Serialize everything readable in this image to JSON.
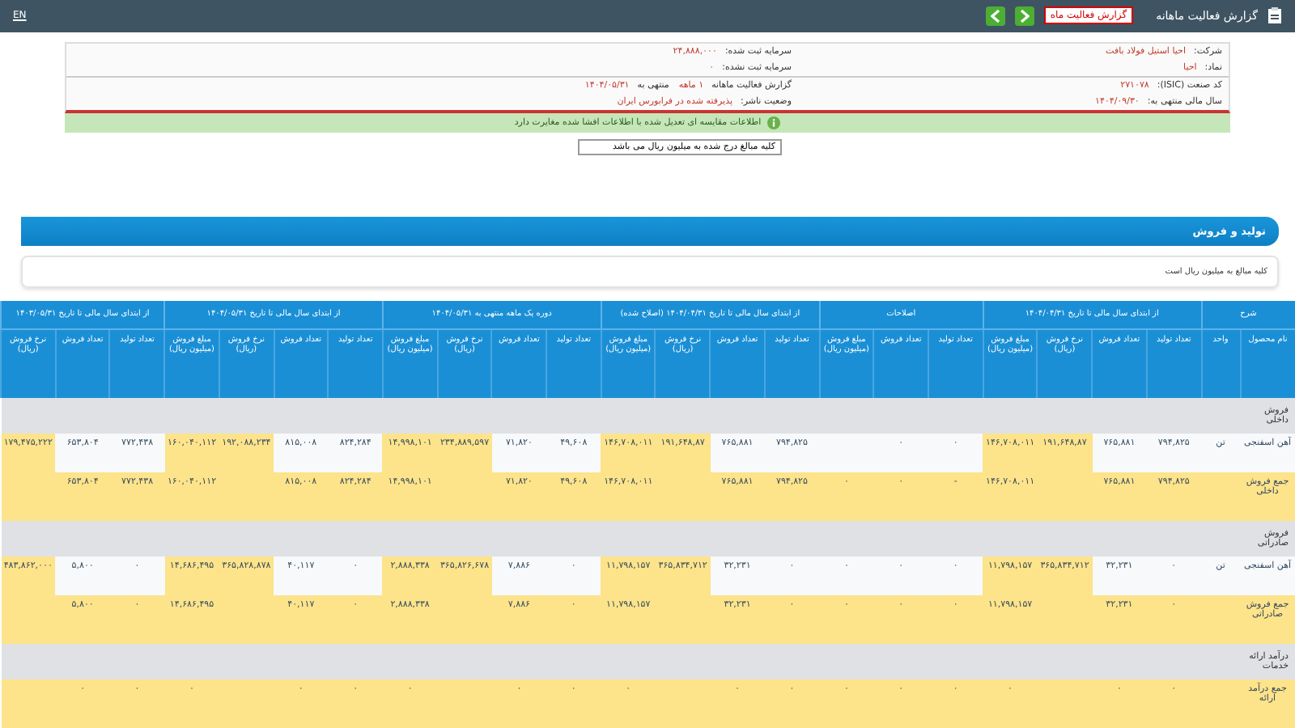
{
  "header": {
    "title": "گزارش فعالیت ماهانه",
    "badge": "گزارش فعالیت ماه",
    "language": "EN"
  },
  "info": [
    [
      {
        "label": "شرکت:",
        "value": "احیا استیل فولاد بافت"
      },
      {
        "label": "سرمایه ثبت شده:",
        "value": "۲۴,۸۸۸,۰۰۰"
      }
    ],
    [
      {
        "label": "نماد:",
        "value": "احیا"
      },
      {
        "label": "سرمایه ثبت نشده:",
        "value": "۰"
      }
    ],
    [
      {
        "label": "کد صنعت (ISIC):",
        "value": "۲۷۱۰۷۸"
      },
      {
        "label": "گزارش فعالیت ماهانه",
        "value": "۱ ماهه"
      },
      {
        "label": "منتهی به",
        "value": "۱۴۰۴/۰۵/۳۱"
      }
    ],
    [
      {
        "label": "سال مالی منتهی به:",
        "value": "۱۴۰۴/۰۹/۳۰"
      },
      {
        "label": "وضعیت ناشر:",
        "value": "پذیرفته شده در فرابورس ایران"
      }
    ]
  ],
  "notice": "اطلاعات مقایسه ای تعدیل شده با اطلاعات افشا شده مغایرت دارد",
  "unit_select": {
    "value": "کلیه مبالغ درج شده به میلیون ریال می باشد"
  },
  "section": {
    "title": "تولید و فروش",
    "note": "کلیه مبالغ به میلیون ریال است"
  },
  "table": {
    "groups": [
      {
        "label": "شرح",
        "columns": [
          {
            "label": "نام محصول",
            "kind": "text"
          },
          {
            "label": "واحد",
            "kind": "text"
          }
        ]
      },
      {
        "label": "از ابتدای سال مالی تا تاریخ ۱۴۰۴/۰۴/۳۱",
        "columns": [
          {
            "label": "تعداد تولید",
            "kind": "qty"
          },
          {
            "label": "تعداد فروش",
            "kind": "qty"
          },
          {
            "label": "نرخ فروش (ریال)",
            "kind": "rate"
          },
          {
            "label": "مبلغ فروش (میلیون ریال)",
            "kind": "amount"
          }
        ]
      },
      {
        "label": "اصلاحات",
        "columns": [
          {
            "label": "تعداد تولید",
            "kind": "qty"
          },
          {
            "label": "تعداد فروش",
            "kind": "qty"
          },
          {
            "label": "مبلغ فروش (میلیون ریال)",
            "kind": "qty"
          }
        ]
      },
      {
        "label": "از ابتدای سال مالی تا تاریخ ۱۴۰۴/۰۴/۳۱ (اصلاح شده)",
        "columns": [
          {
            "label": "تعداد تولید",
            "kind": "qty"
          },
          {
            "label": "تعداد فروش",
            "kind": "qty"
          },
          {
            "label": "نرخ فروش (ریال)",
            "kind": "rate"
          },
          {
            "label": "مبلغ فروش (میلیون ریال)",
            "kind": "amount"
          }
        ]
      },
      {
        "label": "دوره یک ماهه منتهی به ۱۴۰۴/۰۵/۳۱",
        "columns": [
          {
            "label": "تعداد تولید",
            "kind": "qty"
          },
          {
            "label": "تعداد فروش",
            "kind": "qty"
          },
          {
            "label": "نرخ فروش (ریال)",
            "kind": "rate"
          },
          {
            "label": "مبلغ فروش (میلیون ریال)",
            "kind": "amount"
          }
        ]
      },
      {
        "label": "از ابتدای سال مالی تا تاریخ ۱۴۰۴/۰۵/۳۱",
        "columns": [
          {
            "label": "تعداد تولید",
            "kind": "qty"
          },
          {
            "label": "تعداد فروش",
            "kind": "qty"
          },
          {
            "label": "نرخ فروش (ریال)",
            "kind": "rate"
          },
          {
            "label": "مبلغ فروش (میلیون ریال)",
            "kind": "amount"
          }
        ]
      },
      {
        "label": "از ابتدای سال مالی تا تاریخ ۱۴۰۳/۰۵/۳۱",
        "columns": [
          {
            "label": "تعداد تولید",
            "kind": "qty"
          },
          {
            "label": "تعداد فروش",
            "kind": "qty"
          },
          {
            "label": "نرخ فروش (ریال)",
            "kind": "rate"
          }
        ]
      }
    ],
    "rows": [
      {
        "kind": "section",
        "cells": [
          "فروش داخلی"
        ]
      },
      {
        "kind": "item",
        "cells": [
          "آهن اسفنجی",
          "تن",
          "۷۹۴,۸۲۵",
          "۷۶۵,۸۸۱",
          "۱۹۱,۶۴۸,۸۷",
          "۱۴۶,۷۰۸,۰۱۱",
          "۰",
          "۰",
          "",
          "۷۹۴,۸۲۵",
          "۷۶۵,۸۸۱",
          "۱۹۱,۶۴۸,۸۷",
          "۱۴۶,۷۰۸,۰۱۱",
          "۴۹,۶۰۸",
          "۷۱,۸۲۰",
          "۲۳۴,۸۸۹,۵۹۷",
          "۱۴,۹۹۸,۱۰۱",
          "۸۲۴,۲۸۴",
          "۸۱۵,۰۰۸",
          "۱۹۲,۰۸۸,۲۳۴",
          "۱۶۰,۰۴۰,۱۱۲",
          "۷۷۲,۴۳۸",
          "۶۵۳,۸۰۴",
          "۱۷۹,۴۷۵,۲۲۲"
        ]
      },
      {
        "kind": "total",
        "cells": [
          "جمع فروش داخلی",
          "",
          "۷۹۴,۸۲۵",
          "۷۶۵,۸۸۱",
          "",
          "۱۴۶,۷۰۸,۰۱۱",
          "-",
          "۰",
          "۰",
          "۷۹۴,۸۲۵",
          "۷۶۵,۸۸۱",
          "",
          "۱۴۶,۷۰۸,۰۱۱",
          "۴۹,۶۰۸",
          "۷۱,۸۲۰",
          "",
          "۱۴,۹۹۸,۱۰۱",
          "۸۲۴,۲۸۴",
          "۸۱۵,۰۰۸",
          "",
          "۱۶۰,۰۴۰,۱۱۲",
          "۷۷۲,۴۳۸",
          "۶۵۳,۸۰۴",
          ""
        ]
      },
      {
        "kind": "section",
        "cells": [
          "فروش صادراتی"
        ]
      },
      {
        "kind": "item",
        "cells": [
          "آهن اسفنجی",
          "تن",
          "۰",
          "۳۲,۲۳۱",
          "۳۶۵,۸۳۴,۷۱۲",
          "۱۱,۷۹۸,۱۵۷",
          "۰",
          "۰",
          "۰",
          "۰",
          "۳۲,۲۳۱",
          "۳۶۵,۸۳۴,۷۱۲",
          "۱۱,۷۹۸,۱۵۷",
          "۰",
          "۷,۸۸۶",
          "۳۶۵,۸۲۶,۶۷۸",
          "۲,۸۸۸,۳۳۸",
          "۰",
          "۴۰,۱۱۷",
          "۳۶۵,۸۲۸,۸۷۸",
          "۱۴,۶۸۶,۴۹۵",
          "۰",
          "۵,۸۰۰",
          "۴۸۳,۸۶۲,۰۰۰"
        ]
      },
      {
        "kind": "total",
        "cells": [
          "جمع فروش صادراتی",
          "",
          "۰",
          "۳۲,۲۳۱",
          "",
          "۱۱,۷۹۸,۱۵۷",
          "۰",
          "۰",
          "۰",
          "۰",
          "۳۲,۲۳۱",
          "",
          "۱۱,۷۹۸,۱۵۷",
          "۰",
          "۷,۸۸۶",
          "",
          "۲,۸۸۸,۳۳۸",
          "۰",
          "۴۰,۱۱۷",
          "",
          "۱۴,۶۸۶,۴۹۵",
          "۰",
          "۵,۸۰۰",
          ""
        ]
      },
      {
        "kind": "section",
        "cells": [
          "درآمد ارائه خدمات"
        ]
      },
      {
        "kind": "total",
        "cells": [
          "جمع درآمد ارائه",
          "",
          "۰",
          "۰",
          "",
          "۰",
          "۰",
          "۰",
          "۰",
          "۰",
          "۰",
          "",
          "۰",
          "۰",
          "۰",
          "",
          "۰",
          "۰",
          "۰",
          "",
          "۰",
          "۰",
          "۰",
          ""
        ]
      }
    ]
  }
}
